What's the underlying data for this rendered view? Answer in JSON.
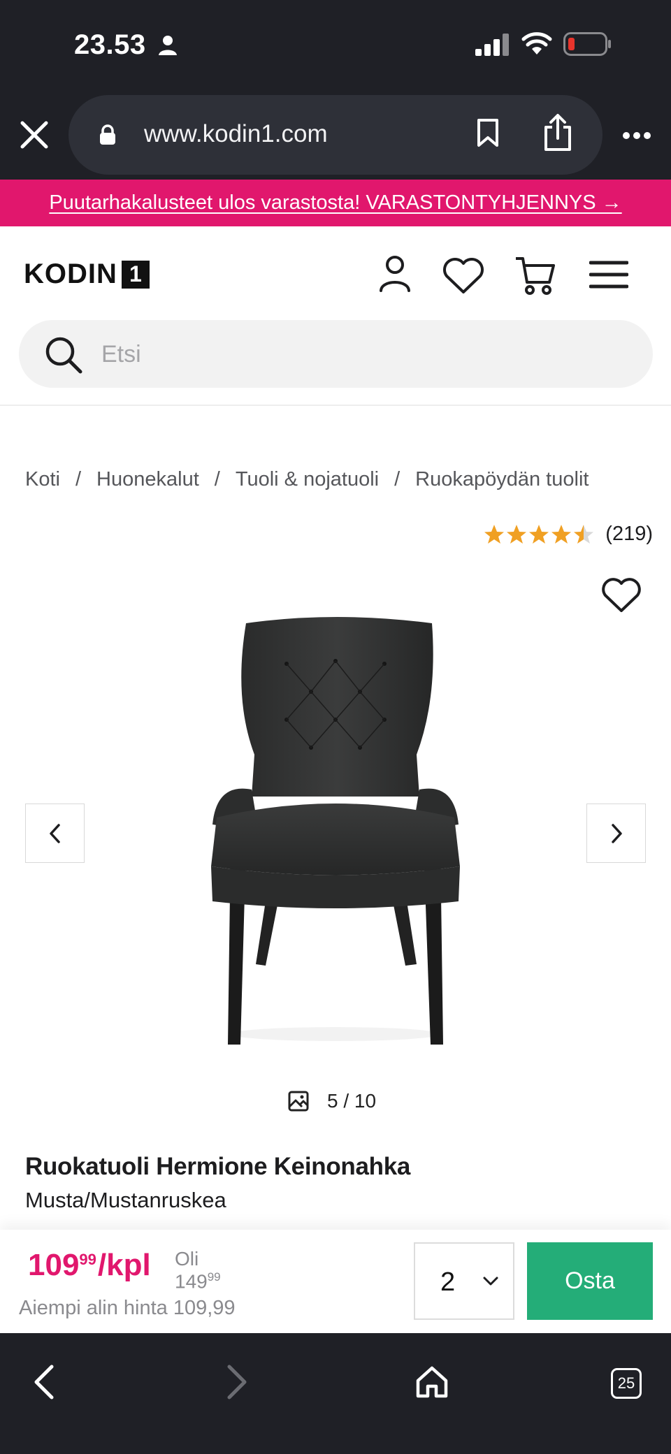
{
  "status_bar": {
    "time": "23.53"
  },
  "browser": {
    "url": "www.kodin1.com",
    "tabs_count": "25"
  },
  "promo": {
    "text": "Puutarhakalusteet ulos varastosta! VARASTONTYHJENNYS →"
  },
  "header": {
    "logo_text": "KODIN",
    "logo_box": "1"
  },
  "search": {
    "placeholder": "Etsi"
  },
  "breadcrumbs": {
    "items": [
      "Koti",
      "Huonekalut",
      "Tuoli & nojatuoli",
      "Ruokapöydän tuolit"
    ],
    "separator": "/"
  },
  "rating": {
    "stars": 4.5,
    "count": "(219)"
  },
  "gallery": {
    "counter": "5 / 10"
  },
  "product": {
    "title": "Ruokatuoli Hermione Keinonahka",
    "variant": "Musta/Mustanruskea"
  },
  "buy_bar": {
    "price_main": "109",
    "price_cents": "99",
    "price_unit": "/kpl",
    "was_label": "Oli",
    "was_main": "149",
    "was_cents": "99",
    "lowest_price": "Aiempi alin hinta 109,99",
    "quantity": "2",
    "buy_label": "Osta"
  },
  "colors": {
    "brand_pink": "#e1176d",
    "buy_green": "#24ad78",
    "dark_chrome": "#1f2026",
    "star_orange": "#f0a023"
  }
}
